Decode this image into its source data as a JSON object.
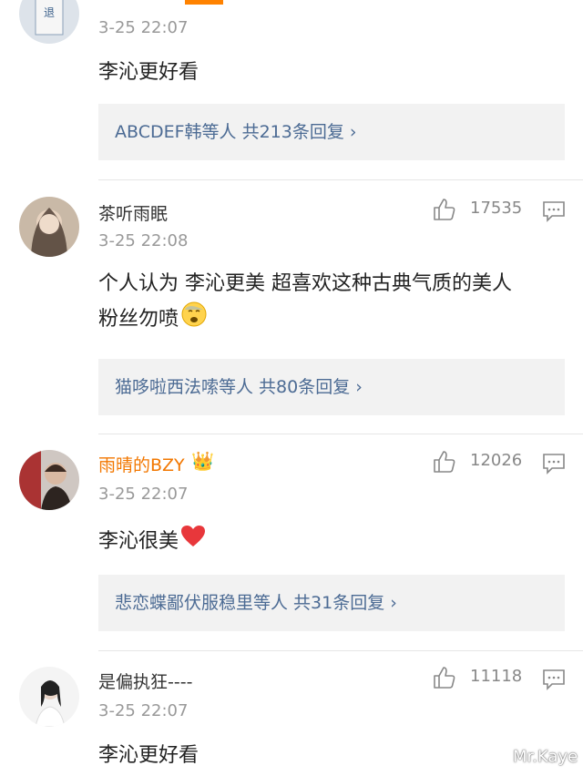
{
  "comments": [
    {
      "username": "",
      "timestamp": "3-25 22:07",
      "text": "李沁更好看",
      "replies_link": "ABCDEF韩等人  共213条回复 ›"
    },
    {
      "username": "茶听雨眠",
      "timestamp": "3-25 22:08",
      "likes": "17535",
      "text_line1": "个人认为 李沁更美 超喜欢这种古典气质的美人",
      "text_line2": "粉丝勿喷",
      "emoji": "fearful-face-emoji",
      "replies_link": "猫哆啦西法嗦等人  共80条回复 ›"
    },
    {
      "username": "雨晴的BZY",
      "vip_badge": "👑",
      "timestamp": "3-25 22:07",
      "likes": "12026",
      "text": "李沁很美",
      "emoji": "red-heart-emoji",
      "replies_link": "悲恋蝶鄙伏服稳里等人  共31条回复 ›"
    },
    {
      "username": "是偏执狂----",
      "timestamp": "3-25 22:07",
      "likes": "11118",
      "text": "李沁更好看"
    }
  ],
  "watermark": "Mr.Kaye",
  "colors": {
    "accent": "#ff8200",
    "link": "#4c6b94",
    "vip_name": "#f27700",
    "muted": "#999999"
  }
}
